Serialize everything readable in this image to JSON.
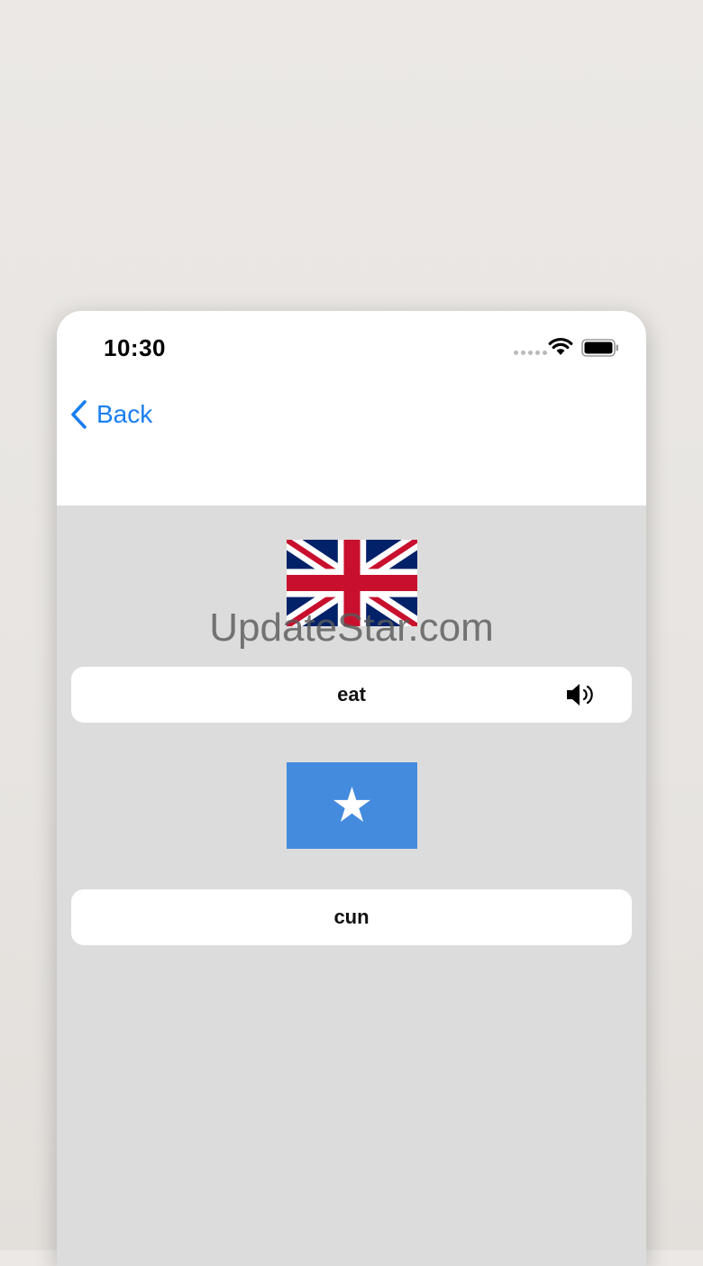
{
  "status_bar": {
    "time": "10:30",
    "wifi_icon": "wifi-icon",
    "battery_icon": "battery-icon"
  },
  "nav": {
    "back_label": "Back",
    "back_icon": "chevron-left-icon",
    "accent_color": "#1a7ef2"
  },
  "source_card": {
    "flag": "united-kingdom-flag",
    "word": "eat",
    "audio_icon": "speaker-icon"
  },
  "target_card": {
    "flag": "somalia-flag",
    "word": "cun"
  },
  "watermark": "UpdateStar.com"
}
